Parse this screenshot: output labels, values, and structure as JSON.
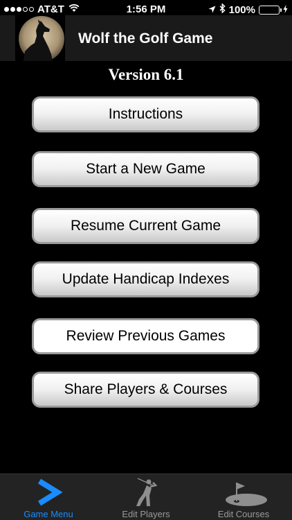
{
  "status_bar": {
    "carrier": "AT&T",
    "time": "1:56 PM",
    "battery": "100%"
  },
  "header": {
    "title": "Wolf the Golf Game"
  },
  "version": "Version 6.1",
  "menu": {
    "instructions": "Instructions",
    "start_new_game": "Start a New Game",
    "resume_game": "Resume Current Game",
    "update_handicap": "Update Handicap Indexes",
    "review_games": "Review Previous Games",
    "share": "Share Players & Courses"
  },
  "tabs": {
    "game_menu": "Game Menu",
    "edit_players": "Edit Players",
    "edit_courses": "Edit Courses"
  },
  "colors": {
    "active_tab": "#1a8cff",
    "battery": "#4cd964"
  }
}
